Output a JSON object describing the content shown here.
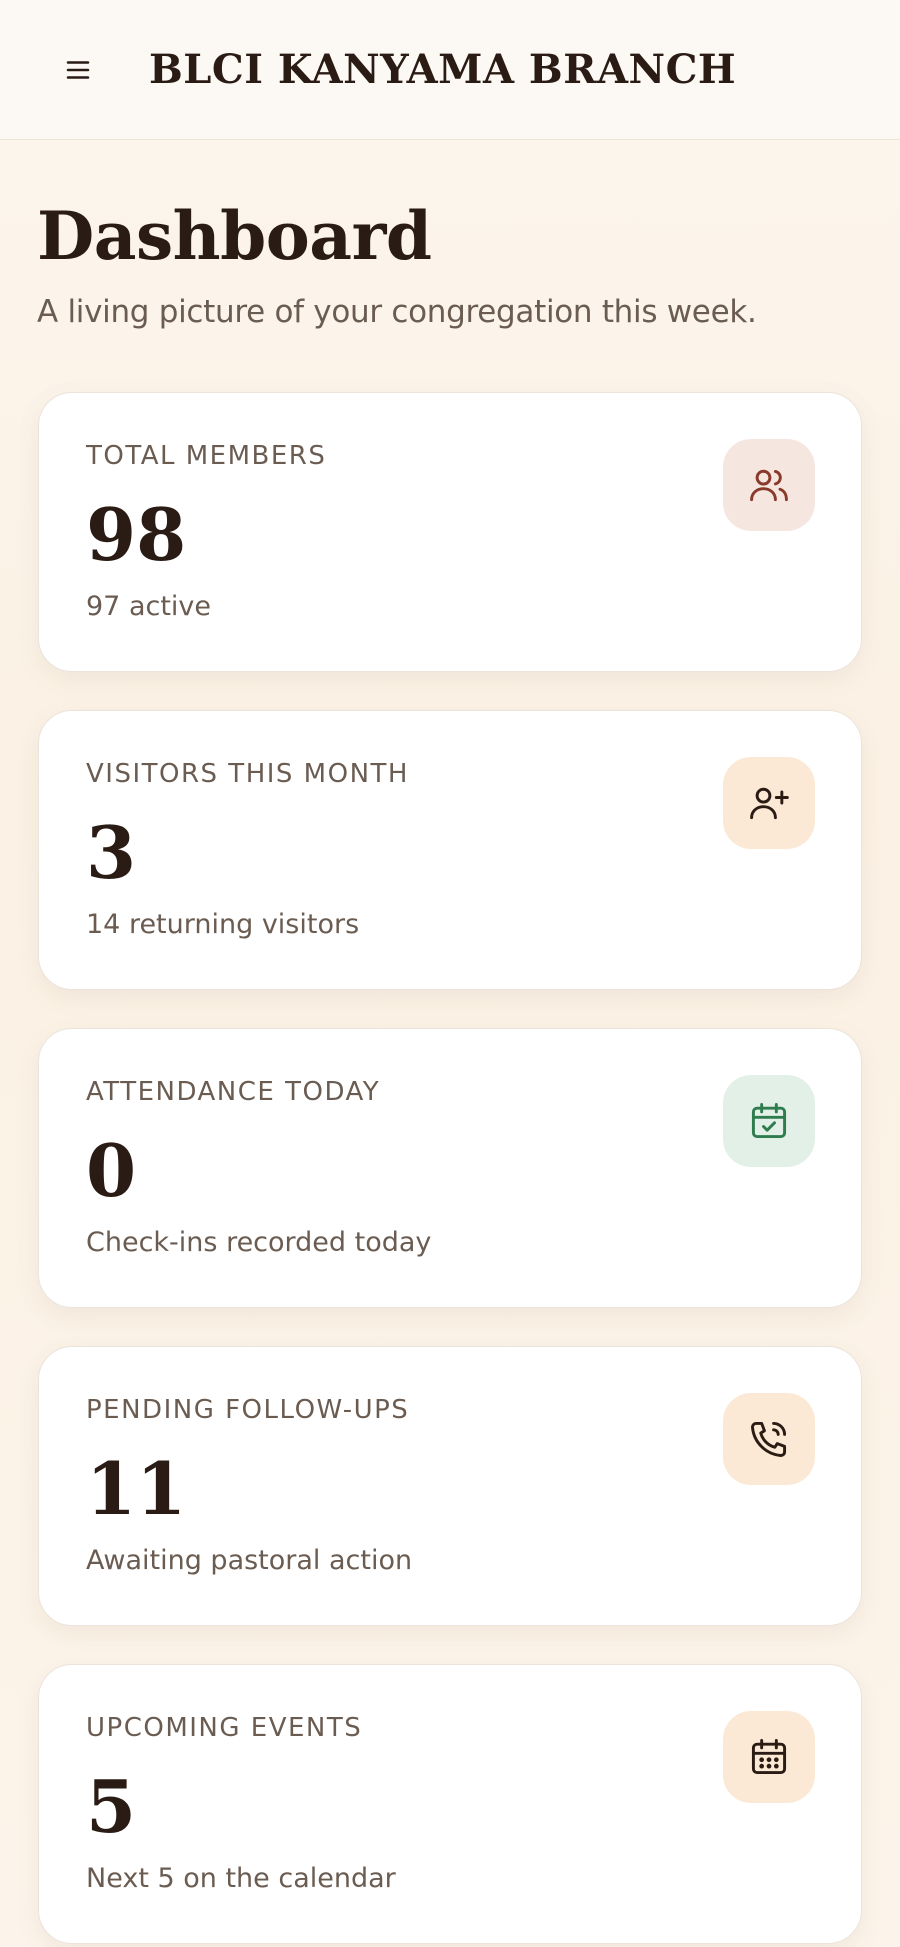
{
  "header": {
    "brand": "BLCI KANYAMA BRANCH",
    "menu_icon": "hamburger-menu-icon"
  },
  "page": {
    "title": "Dashboard",
    "subtitle": "A living picture of your congregation this week."
  },
  "cards": [
    {
      "label": "TOTAL MEMBERS",
      "value": "98",
      "note": "97 active",
      "icon": "users-icon",
      "icon_bg": "#f5e6e0",
      "icon_color": "#8a3a2a"
    },
    {
      "label": "VISITORS THIS MONTH",
      "value": "3",
      "note": "14 returning visitors",
      "icon": "user-plus-icon",
      "icon_bg": "#fbe9d5",
      "icon_color": "#2a1c14"
    },
    {
      "label": "ATTENDANCE TODAY",
      "value": "0",
      "note": "Check-ins recorded today",
      "icon": "calendar-check-icon",
      "icon_bg": "#e2f0e7",
      "icon_color": "#2f7d4f"
    },
    {
      "label": "PENDING FOLLOW-UPS",
      "value": "11",
      "note": "Awaiting pastoral action",
      "icon": "phone-call-icon",
      "icon_bg": "#fbe9d5",
      "icon_color": "#2a1c14"
    },
    {
      "label": "UPCOMING EVENTS",
      "value": "5",
      "note": "Next 5 on the calendar",
      "icon": "calendar-grid-icon",
      "icon_bg": "#fbe9d5",
      "icon_color": "#2a1c14"
    }
  ]
}
